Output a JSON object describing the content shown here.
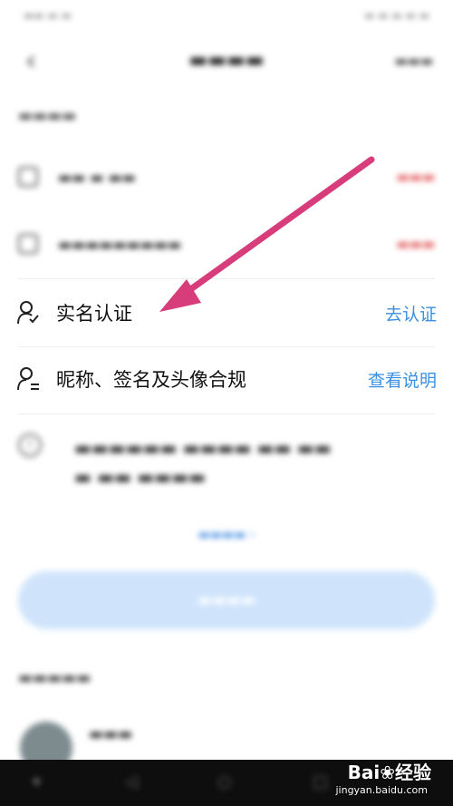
{
  "header": {
    "back_icon": "chevron-left-icon"
  },
  "items": {
    "real_name": {
      "label": "实名认证",
      "action": "去认证"
    },
    "nickname": {
      "label": "昵称、签名及头像合规",
      "action": "查看说明"
    }
  },
  "annotation": {
    "arrow_color": "#d63d7a"
  },
  "colors": {
    "link": "#3a8fe0",
    "status_red": "#e25555",
    "submit_bg": "#cfe4fb"
  }
}
